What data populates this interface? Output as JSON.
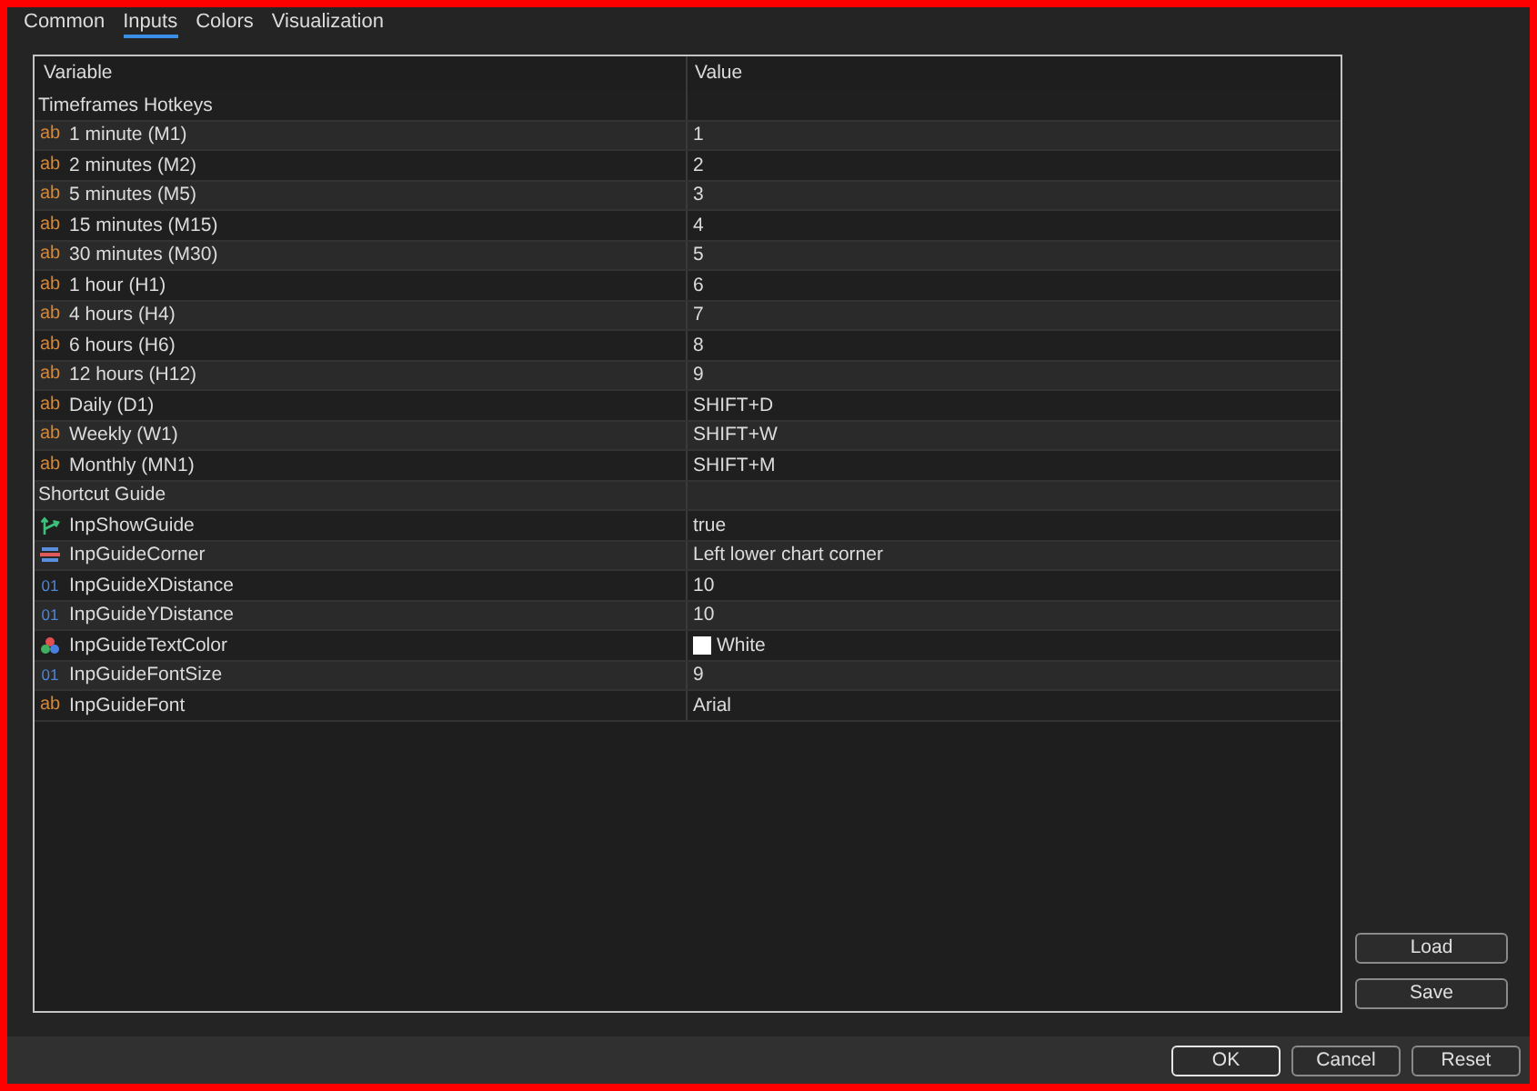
{
  "tabs": [
    {
      "label": "Common",
      "selected": false
    },
    {
      "label": "Inputs",
      "selected": true
    },
    {
      "label": "Colors",
      "selected": false
    },
    {
      "label": "Visualization",
      "selected": false
    }
  ],
  "table": {
    "columns": [
      "Variable",
      "Value"
    ],
    "rows": [
      {
        "kind": "group",
        "label": "Timeframes Hotkeys"
      },
      {
        "kind": "string",
        "icon": "ab",
        "label": "1 minute (M1)",
        "value": "1"
      },
      {
        "kind": "string",
        "icon": "ab",
        "label": "2 minutes (M2)",
        "value": "2"
      },
      {
        "kind": "string",
        "icon": "ab",
        "label": "5 minutes (M5)",
        "value": "3"
      },
      {
        "kind": "string",
        "icon": "ab",
        "label": "15 minutes (M15)",
        "value": "4"
      },
      {
        "kind": "string",
        "icon": "ab",
        "label": "30 minutes (M30)",
        "value": "5"
      },
      {
        "kind": "string",
        "icon": "ab",
        "label": "1 hour (H1)",
        "value": "6"
      },
      {
        "kind": "string",
        "icon": "ab",
        "label": "4 hours (H4)",
        "value": "7"
      },
      {
        "kind": "string",
        "icon": "ab",
        "label": "6 hours (H6)",
        "value": "8"
      },
      {
        "kind": "string",
        "icon": "ab",
        "label": "12 hours (H12)",
        "value": "9"
      },
      {
        "kind": "string",
        "icon": "ab",
        "label": "Daily (D1)",
        "value": "SHIFT+D"
      },
      {
        "kind": "string",
        "icon": "ab",
        "label": "Weekly (W1)",
        "value": "SHIFT+W"
      },
      {
        "kind": "string",
        "icon": "ab",
        "label": "Monthly (MN1)",
        "value": "SHIFT+M"
      },
      {
        "kind": "group",
        "label": "Shortcut Guide"
      },
      {
        "kind": "bool",
        "label": "InpShowGuide",
        "value": "true"
      },
      {
        "kind": "enum",
        "label": "InpGuideCorner",
        "value": "Left lower chart corner"
      },
      {
        "kind": "int",
        "icon": "01",
        "label": "InpGuideXDistance",
        "value": "10"
      },
      {
        "kind": "int",
        "icon": "01",
        "label": "InpGuideYDistance",
        "value": "10"
      },
      {
        "kind": "color",
        "label": "InpGuideTextColor",
        "value": "White",
        "color": "#ffffff"
      },
      {
        "kind": "int",
        "icon": "01",
        "label": "InpGuideFontSize",
        "value": "9"
      },
      {
        "kind": "string",
        "icon": "ab",
        "label": "InpGuideFont",
        "value": "Arial"
      }
    ]
  },
  "side_buttons": [
    "Load",
    "Save"
  ],
  "buttons": [
    {
      "label": "OK",
      "default": true
    },
    {
      "label": "Cancel",
      "default": false
    },
    {
      "label": "Reset",
      "default": false
    }
  ]
}
